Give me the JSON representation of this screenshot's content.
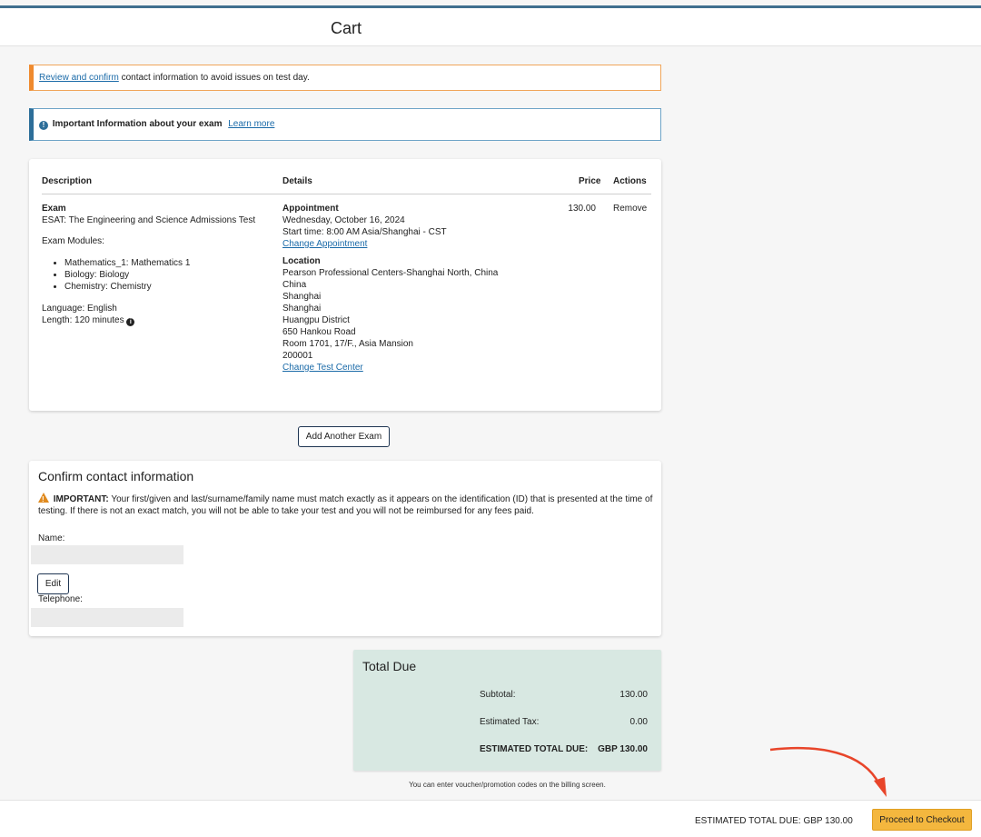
{
  "header": {
    "title": "Cart"
  },
  "alerts": {
    "review_link": "Review and confirm",
    "review_text": "contact information to avoid issues on test day.",
    "info_bold": "Important Information about your exam",
    "info_link": "Learn more"
  },
  "table": {
    "headers": {
      "description": "Description",
      "details": "Details",
      "price": "Price",
      "actions": "Actions"
    },
    "row": {
      "exam_title": "Exam",
      "exam_name": "ESAT: The Engineering and Science Admissions Test",
      "modules_label": "Exam Modules:",
      "modules": [
        "Mathematics_1: Mathematics 1",
        "Biology: Biology",
        "Chemistry: Chemistry"
      ],
      "language": "Language: English",
      "length": "Length: 120 minutes",
      "appointment_title": "Appointment",
      "appointment_date": "Wednesday, October 16, 2024",
      "appointment_time": "Start time: 8:00 AM Asia/Shanghai - CST",
      "change_appointment": "Change Appointment",
      "location_title": "Location",
      "location_lines": [
        "Pearson Professional Centers-Shanghai North, China",
        "China",
        "Shanghai",
        "Shanghai",
        "Huangpu District",
        "650 Hankou Road",
        "Room 1701, 17/F., Asia Mansion",
        "200001"
      ],
      "change_test_center": "Change Test Center",
      "price": "130.00",
      "remove": "Remove"
    }
  },
  "add_exam_label": "Add Another Exam",
  "contact": {
    "title": "Confirm contact information",
    "important_label": "IMPORTANT:",
    "important_text": "Your first/given and last/surname/family name must match exactly as it appears on the identification (ID) that is presented at the time of testing. If there is not an exact match, you will not be able to take your test and you will not be reimbursed for any fees paid.",
    "name_label": "Name:",
    "edit_label": "Edit",
    "telephone_label": "Telephone:"
  },
  "totals": {
    "title": "Total Due",
    "subtotal_label": "Subtotal:",
    "subtotal_value": "130.00",
    "tax_label": "Estimated Tax:",
    "tax_value": "0.00",
    "total_label": "ESTIMATED TOTAL DUE:",
    "total_value": "GBP 130.00"
  },
  "voucher_note": "You can enter voucher/promotion codes on the billing screen.",
  "footer": {
    "estimated": "ESTIMATED TOTAL DUE: GBP 130.00",
    "checkout_label": "Proceed to Checkout"
  },
  "colors": {
    "accent": "#1a6aa8",
    "warning": "#ef8a2e",
    "checkout": "#f4b73e",
    "total_bg": "#d8e8e2",
    "annotation_arrow": "#e8452a"
  }
}
